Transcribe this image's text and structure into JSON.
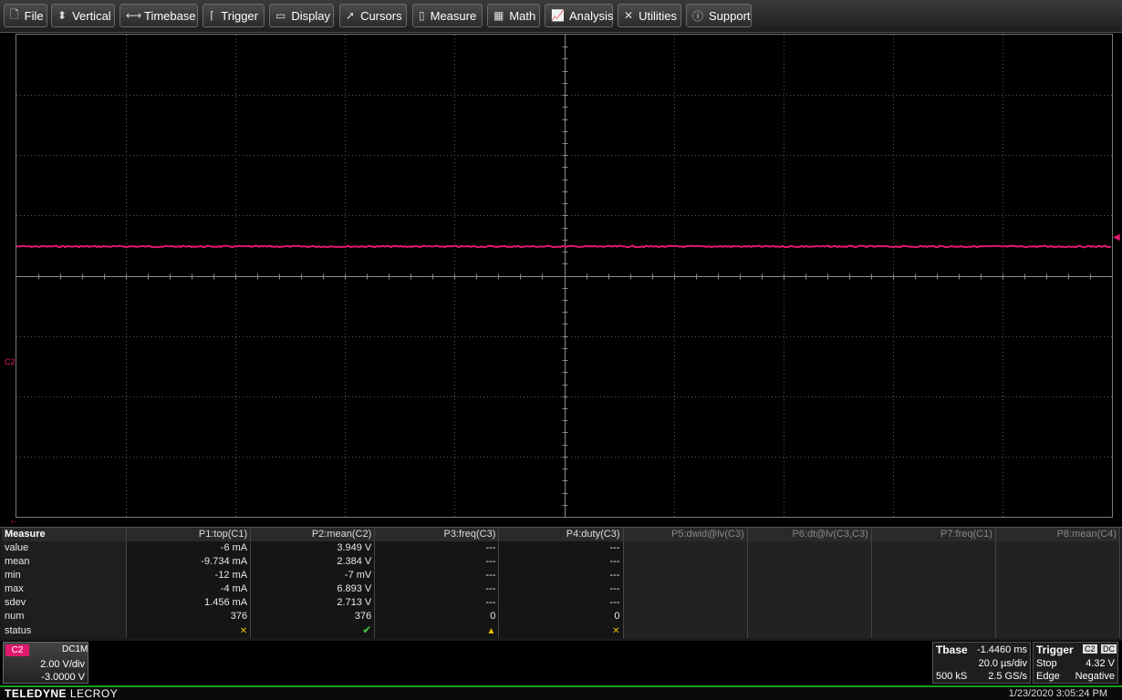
{
  "menu": [
    {
      "label": "File",
      "icon": "file-icon",
      "glyph": "🗋"
    },
    {
      "label": "Vertical",
      "icon": "vertical-icon",
      "glyph": "⬍"
    },
    {
      "label": "Timebase",
      "icon": "timebase-icon",
      "glyph": "⟷"
    },
    {
      "label": "Trigger",
      "icon": "trigger-icon",
      "glyph": "⌈"
    },
    {
      "label": "Display",
      "icon": "display-icon",
      "glyph": "▭"
    },
    {
      "label": "Cursors",
      "icon": "cursors-icon",
      "glyph": "➚"
    },
    {
      "label": "Measure",
      "icon": "measure-icon",
      "glyph": "▯"
    },
    {
      "label": "Math",
      "icon": "math-icon",
      "glyph": "▦"
    },
    {
      "label": "Analysis",
      "icon": "analysis-icon",
      "glyph": "📈"
    },
    {
      "label": "Utilities",
      "icon": "utilities-icon",
      "glyph": "✕"
    },
    {
      "label": "Support",
      "icon": "support-icon",
      "glyph": "ⓘ"
    }
  ],
  "trace": {
    "channel_label": "C2",
    "color": "#e0186e",
    "level_divisions": 0.5
  },
  "measure": {
    "header": "Measure",
    "columns": [
      "P1:top(C1)",
      "P2:mean(C2)",
      "P3:freq(C3)",
      "P4:duty(C3)",
      "P5:dwid@lv(C3)",
      "P6:dt@lv(C3,C3)",
      "P7:freq(C1)",
      "P8:mean(C4)"
    ],
    "rows": [
      {
        "label": "value",
        "cells": [
          "-6 mA",
          "3.949 V",
          "---",
          "---"
        ]
      },
      {
        "label": "mean",
        "cells": [
          "-9.734 mA",
          "2.384 V",
          "---",
          "---"
        ]
      },
      {
        "label": "min",
        "cells": [
          "-12 mA",
          "-7 mV",
          "---",
          "---"
        ]
      },
      {
        "label": "max",
        "cells": [
          "-4 mA",
          "6.893 V",
          "---",
          "---"
        ]
      },
      {
        "label": "sdev",
        "cells": [
          "1.456 mA",
          "2.713 V",
          "---",
          "---"
        ]
      },
      {
        "label": "num",
        "cells": [
          "376",
          "376",
          "0",
          "0"
        ]
      }
    ],
    "status_label": "status",
    "status": [
      "x",
      "ok",
      "warn",
      "x"
    ]
  },
  "channel": {
    "badge": "C2",
    "coupling": "DC1M",
    "scale": "2.00 V/div",
    "offset": "-3.0000 V"
  },
  "timebase": {
    "title": "Tbase",
    "delay": "-1.4460 ms",
    "scale": "20.0 µs/div",
    "samples": "500 kS",
    "rate": "2.5 GS/s"
  },
  "trigger": {
    "title": "Trigger",
    "source": "C2",
    "coupling": "DC",
    "mode": "Stop",
    "level": "4.32 V",
    "type": "Edge",
    "slope": "Negative"
  },
  "footer": {
    "brand_bold": "TELEDYNE",
    "brand_rest": " LECROY",
    "datetime": "1/23/2020 3:05:24 PM"
  }
}
